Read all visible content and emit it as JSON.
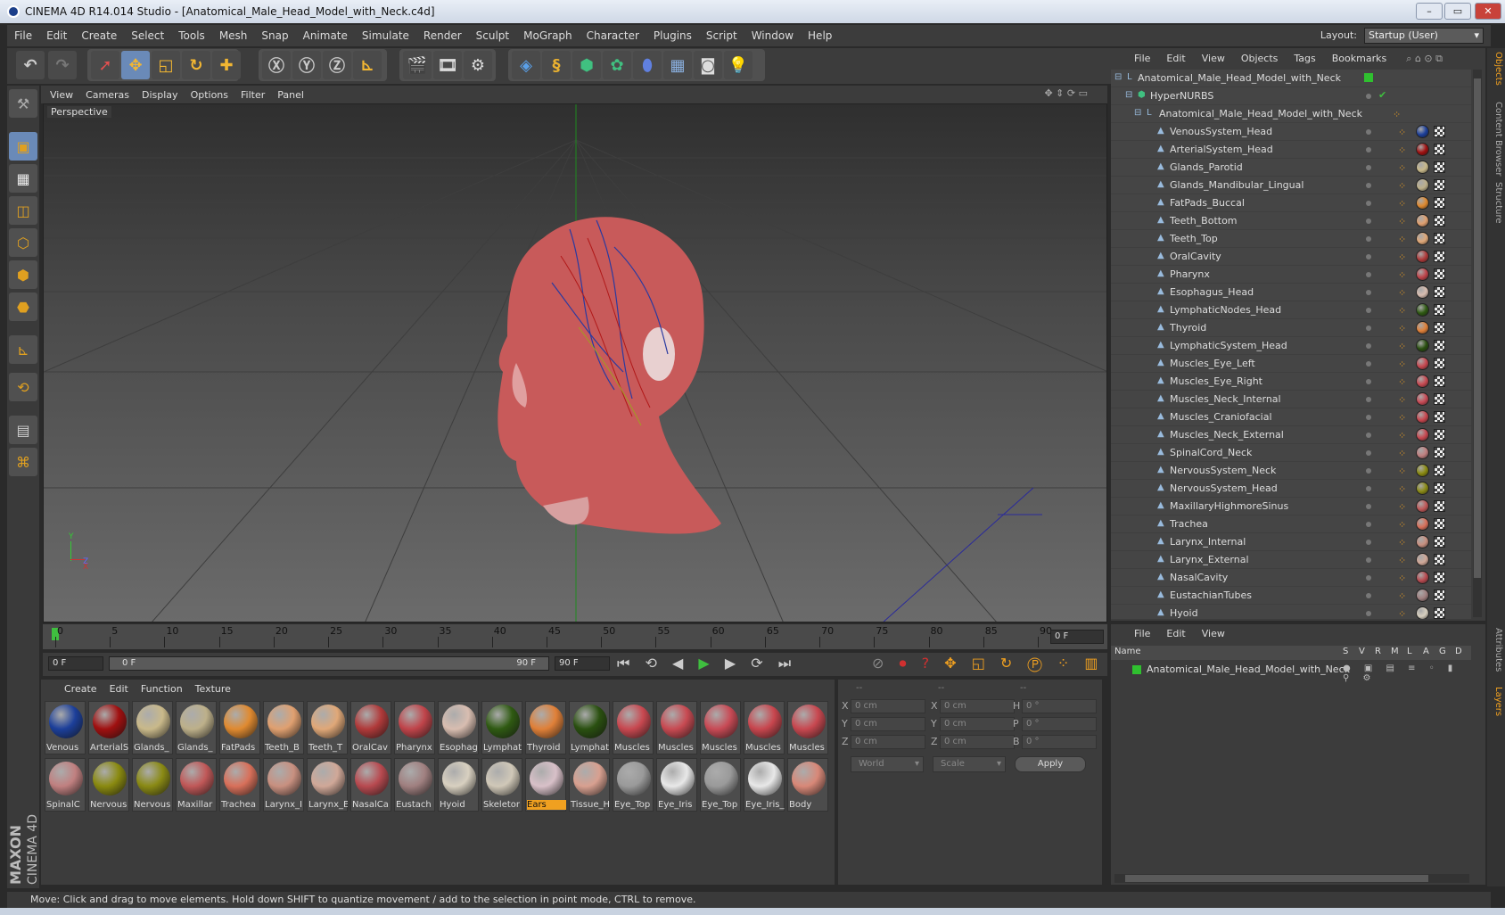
{
  "window": {
    "title": "CINEMA 4D R14.014 Studio - [Anatomical_Male_Head_Model_with_Neck.c4d]"
  },
  "menubar": {
    "items": [
      "File",
      "Edit",
      "Create",
      "Select",
      "Tools",
      "Mesh",
      "Snap",
      "Animate",
      "Simulate",
      "Render",
      "Sculpt",
      "MoGraph",
      "Character",
      "Plugins",
      "Script",
      "Window",
      "Help"
    ],
    "layout_label": "Layout:",
    "layout_value": "Startup (User)"
  },
  "viewport": {
    "menu": [
      "View",
      "Cameras",
      "Display",
      "Options",
      "Filter",
      "Panel"
    ],
    "label": "Perspective"
  },
  "timeline": {
    "ticks": [
      "0",
      "5",
      "10",
      "15",
      "20",
      "25",
      "30",
      "35",
      "40",
      "45",
      "50",
      "55",
      "60",
      "65",
      "70",
      "75",
      "80",
      "85",
      "90"
    ],
    "current_frame": "0 F",
    "start_field": "0 F",
    "range_start": "0 F",
    "range_end": "90 F",
    "end_field": "90 F"
  },
  "materials": {
    "menu": [
      "Create",
      "Edit",
      "Function",
      "Texture"
    ],
    "row1": [
      {
        "label": "Venous",
        "color": "#1c3f9a"
      },
      {
        "label": "ArterialS",
        "color": "#a01010"
      },
      {
        "label": "Glands_",
        "color": "#c9b98a"
      },
      {
        "label": "Glands_",
        "color": "#bdb08a"
      },
      {
        "label": "FatPads",
        "color": "#e08a30"
      },
      {
        "label": "Teeth_B",
        "color": "#e0a070"
      },
      {
        "label": "Teeth_T",
        "color": "#e0a878"
      },
      {
        "label": "OralCav",
        "color": "#b03a3a"
      },
      {
        "label": "Pharynx",
        "color": "#c0444a"
      },
      {
        "label": "Esophag",
        "color": "#d8bdb0"
      },
      {
        "label": "Lymphat",
        "color": "#2f5a12"
      },
      {
        "label": "Thyroid",
        "color": "#e08038"
      },
      {
        "label": "Lymphat",
        "color": "#2a5010"
      },
      {
        "label": "Muscles",
        "color": "#c84850"
      },
      {
        "label": "Muscles",
        "color": "#c84a52"
      },
      {
        "label": "Muscles",
        "color": "#c84a55"
      },
      {
        "label": "Muscles",
        "color": "#c8464e"
      },
      {
        "label": "Muscles",
        "color": "#c84850"
      }
    ],
    "row2": [
      {
        "label": "SpinalC",
        "color": "#c08080"
      },
      {
        "label": "Nervous",
        "color": "#8a8a10"
      },
      {
        "label": "Nervous",
        "color": "#8a8a14"
      },
      {
        "label": "Maxillar",
        "color": "#c05858"
      },
      {
        "label": "Trachea",
        "color": "#d8705a"
      },
      {
        "label": "Larynx_I",
        "color": "#c89080"
      },
      {
        "label": "Larynx_E",
        "color": "#d0a898"
      },
      {
        "label": "NasalCa",
        "color": "#b84a50"
      },
      {
        "label": "Eustach",
        "color": "#a08080"
      },
      {
        "label": "Hyoid",
        "color": "#d8d0c0"
      },
      {
        "label": "Skeletor",
        "color": "#d0c8b8"
      },
      {
        "label": "Ears",
        "color": "#d8c0c8"
      },
      {
        "label": "Tissue_H",
        "color": "#d8a090"
      },
      {
        "label": "Eye_Top",
        "color": "#9a9a9a"
      },
      {
        "label": "Eye_Iris",
        "color": "#e8e8e8"
      },
      {
        "label": "Eye_Top",
        "color": "#9a9a9a"
      },
      {
        "label": "Eye_Iris_",
        "color": "#e8e8e8"
      },
      {
        "label": "Body",
        "color": "#d88878"
      }
    ],
    "selected_label": "Ears"
  },
  "coords": {
    "header": [
      "--",
      "--",
      "--"
    ],
    "rows": [
      {
        "axis": "X",
        "pos": "0 cm",
        "axis2": "X",
        "size": "0 cm",
        "rot_axis": "H",
        "rot": "0 °"
      },
      {
        "axis": "Y",
        "pos": "0 cm",
        "axis2": "Y",
        "size": "0 cm",
        "rot_axis": "P",
        "rot": "0 °"
      },
      {
        "axis": "Z",
        "pos": "0 cm",
        "axis2": "Z",
        "size": "0 cm",
        "rot_axis": "B",
        "rot": "0 °"
      }
    ],
    "mode": "World",
    "transform": "Scale",
    "apply": "Apply"
  },
  "status": {
    "text": "Move: Click and drag to move elements. Hold down SHIFT to quantize movement / add to the selection in point mode, CTRL to remove."
  },
  "objects": {
    "menu": [
      "File",
      "Edit",
      "View",
      "Objects",
      "Tags",
      "Bookmarks"
    ],
    "root": "Anatomical_Male_Head_Model_with_Neck",
    "hypernurbs": "HyperNURBS",
    "group": "Anatomical_Male_Head_Model_with_Neck",
    "items": [
      {
        "name": "VenousSystem_Head",
        "color": "#1c3f9a"
      },
      {
        "name": "ArterialSystem_Head",
        "color": "#a01010"
      },
      {
        "name": "Glands_Parotid",
        "color": "#c9b98a"
      },
      {
        "name": "Glands_Mandibular_Lingual",
        "color": "#bdb08a"
      },
      {
        "name": "FatPads_Buccal",
        "color": "#e08a30"
      },
      {
        "name": "Teeth_Bottom",
        "color": "#e0a070"
      },
      {
        "name": "Teeth_Top",
        "color": "#e0a878"
      },
      {
        "name": "OralCavity",
        "color": "#b03a3a"
      },
      {
        "name": "Pharynx",
        "color": "#c0444a"
      },
      {
        "name": "Esophagus_Head",
        "color": "#d8bdb0"
      },
      {
        "name": "LymphaticNodes_Head",
        "color": "#2f5a12"
      },
      {
        "name": "Thyroid",
        "color": "#e08038"
      },
      {
        "name": "LymphaticSystem_Head",
        "color": "#2a5010"
      },
      {
        "name": "Muscles_Eye_Left",
        "color": "#c84850"
      },
      {
        "name": "Muscles_Eye_Right",
        "color": "#c84a52"
      },
      {
        "name": "Muscles_Neck_Internal",
        "color": "#c84a55"
      },
      {
        "name": "Muscles_Craniofacial",
        "color": "#c8464e"
      },
      {
        "name": "Muscles_Neck_External",
        "color": "#c84850"
      },
      {
        "name": "SpinalCord_Neck",
        "color": "#c08080"
      },
      {
        "name": "NervousSystem_Neck",
        "color": "#8a8a10"
      },
      {
        "name": "NervousSystem_Head",
        "color": "#8a8a14"
      },
      {
        "name": "MaxillaryHighmoreSinus",
        "color": "#c05858"
      },
      {
        "name": "Trachea",
        "color": "#d8705a"
      },
      {
        "name": "Larynx_Internal",
        "color": "#c89080"
      },
      {
        "name": "Larynx_External",
        "color": "#d0a898"
      },
      {
        "name": "NasalCavity",
        "color": "#b84a50"
      },
      {
        "name": "EustachianTubes",
        "color": "#a08080"
      },
      {
        "name": "Hyoid",
        "color": "#d8d0c0"
      }
    ]
  },
  "layers": {
    "menu": [
      "File",
      "Edit",
      "View"
    ],
    "name_header": "Name",
    "flags": [
      "S",
      "V",
      "R",
      "M",
      "L",
      "A",
      "G",
      "D"
    ],
    "item": "Anatomical_Male_Head_Model_with_Neck"
  },
  "right_tabs": [
    "Objects",
    "Content Browser",
    "Structure",
    "Attributes",
    "Layers"
  ],
  "brand": {
    "maxon": "MAXON",
    "product": "CINEMA 4D"
  }
}
